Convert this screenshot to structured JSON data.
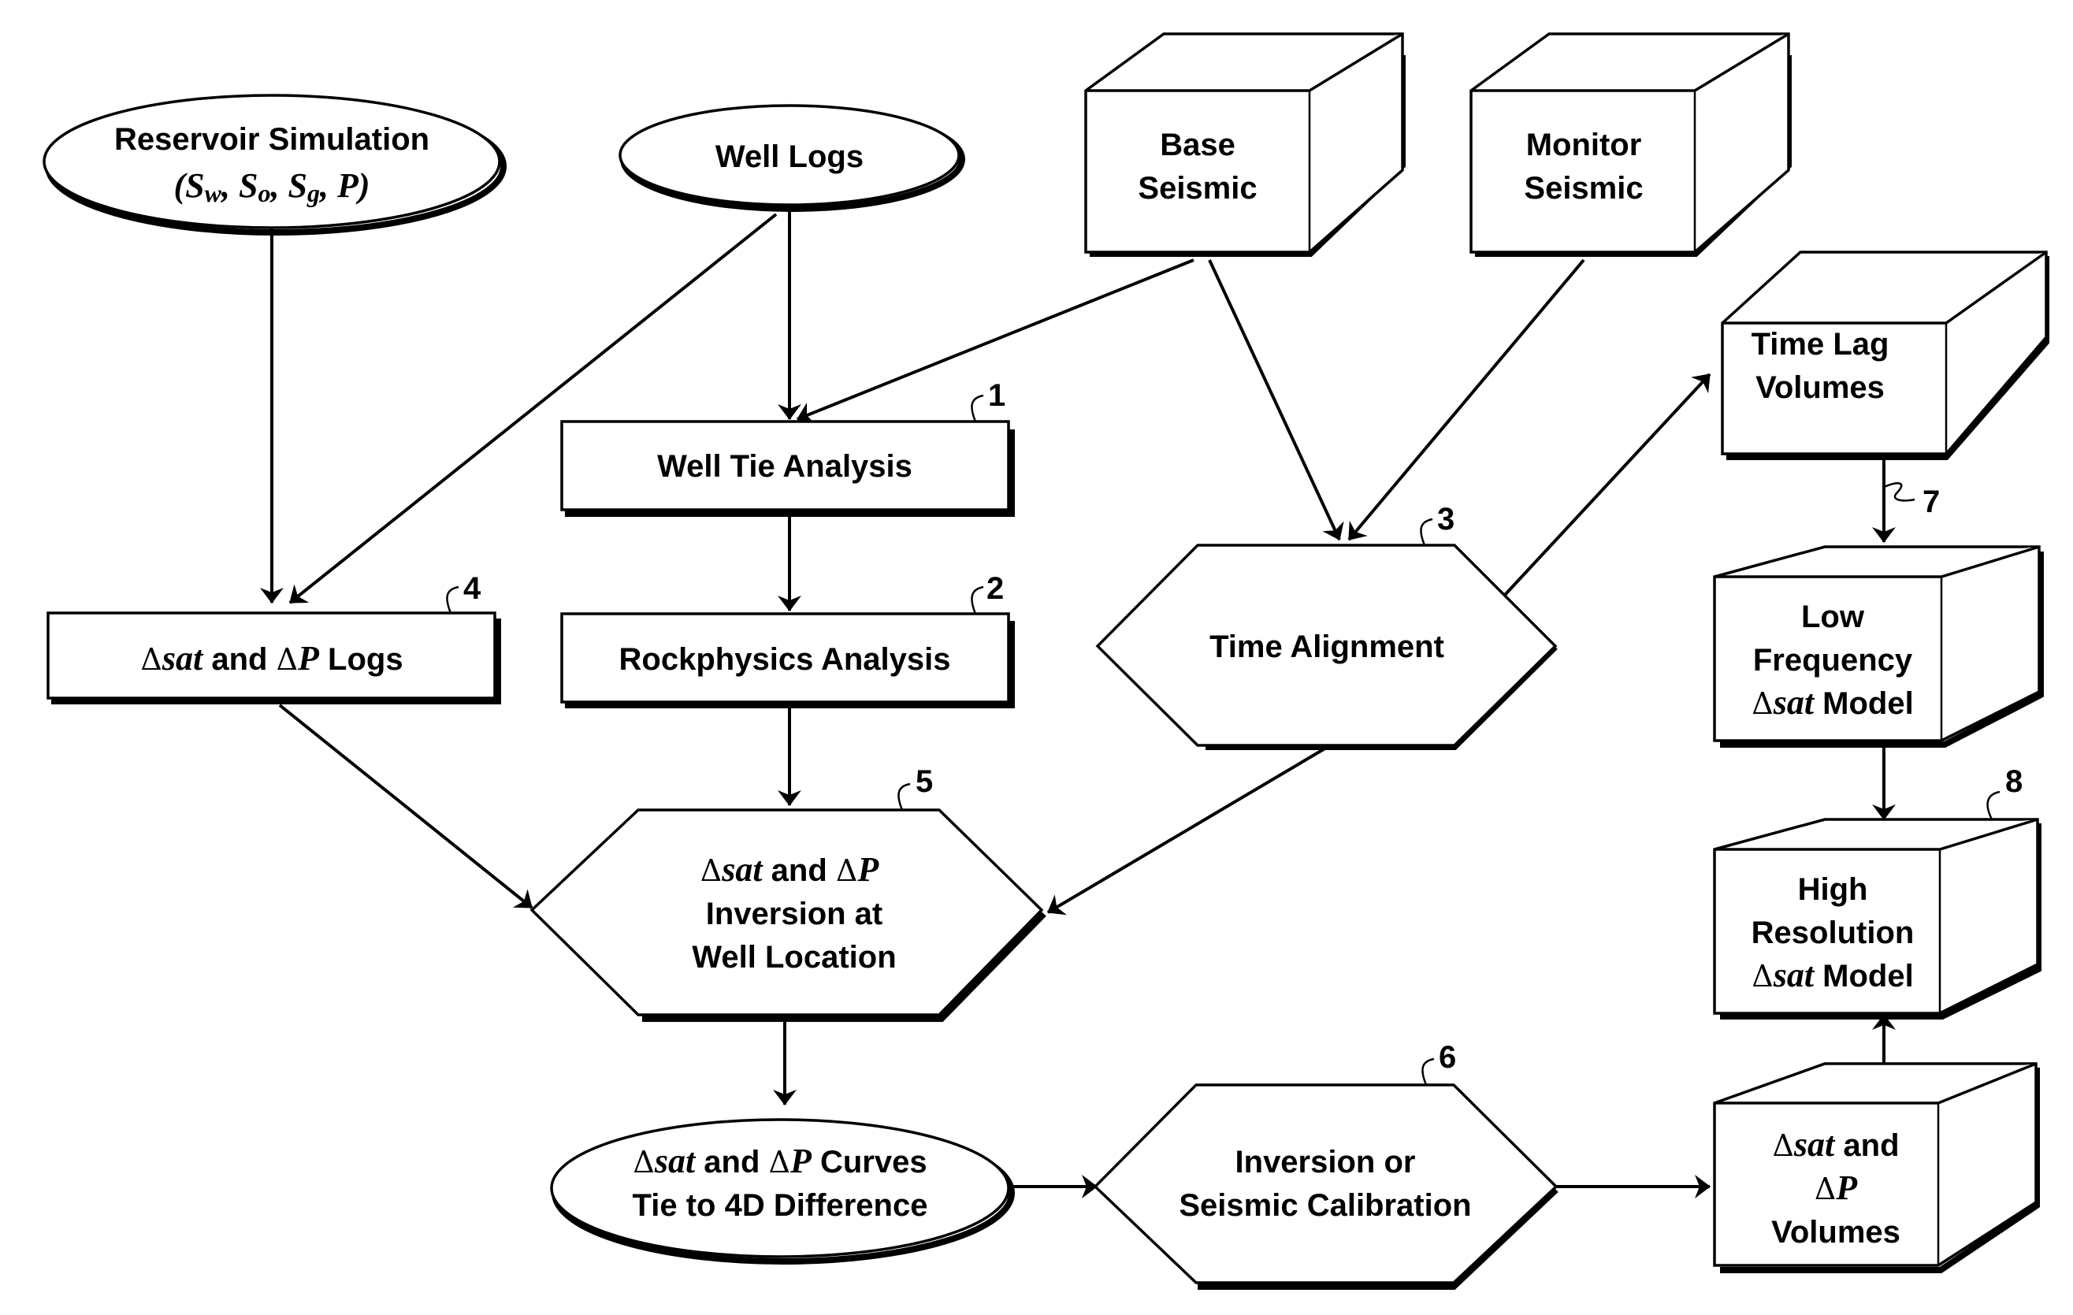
{
  "diagram": {
    "type": "flowchart",
    "nodes": {
      "reservoir_simulation": {
        "line1": "Reservoir Simulation",
        "line2_open": "(",
        "sw": "S",
        "sw_sub": "w",
        "so": "S",
        "so_sub": "o",
        "sg": "S",
        "sg_sub": "g",
        "p": "P",
        "comma": ", ",
        "line2_close": ")"
      },
      "well_logs": {
        "label": "Well Logs"
      },
      "base_seismic": {
        "line1": "Base",
        "line2": "Seismic"
      },
      "monitor_seismic": {
        "line1": "Monitor",
        "line2": "Seismic"
      },
      "time_lag_volumes": {
        "line1": "Time Lag",
        "line2": "Volumes"
      },
      "well_tie_analysis": {
        "label": "Well Tie Analysis",
        "ref": "1"
      },
      "rockphysics_analysis": {
        "label": "Rockphysics Analysis",
        "ref": "2"
      },
      "time_alignment": {
        "label": "Time Alignment",
        "ref": "3"
      },
      "sat_p_logs": {
        "delta": "Δ",
        "sat": "sat",
        "and": " and ",
        "p": "P",
        "tail": " Logs",
        "ref": "4"
      },
      "inversion_at_well": {
        "delta": "Δ",
        "sat": "sat",
        "and": " and ",
        "p": "P",
        "line2": "Inversion at",
        "line3": "Well Location",
        "ref": "5"
      },
      "curves_tie": {
        "delta": "Δ",
        "sat": "sat",
        "and": " and ",
        "p": "P",
        "tail": " Curves",
        "line2": "Tie to 4D Difference"
      },
      "inversion_calibration": {
        "line1": "Inversion or",
        "line2": "Seismic Calibration",
        "ref": "6"
      },
      "low_frequency_model": {
        "line1": "Low",
        "line2": "Frequency",
        "delta": "Δ",
        "sat": "sat",
        "tail": " Model",
        "ref": "7"
      },
      "high_resolution_model": {
        "line1": "High",
        "line2": "Resolution",
        "delta": "Δ",
        "sat": "sat",
        "tail": " Model",
        "ref": "8"
      },
      "sat_p_volumes": {
        "delta": "Δ",
        "sat": "sat",
        "and": " and",
        "p": "P",
        "line3": "Volumes"
      }
    },
    "edges": [
      [
        "reservoir_simulation",
        "sat_p_logs"
      ],
      [
        "well_logs",
        "sat_p_logs"
      ],
      [
        "well_logs",
        "well_tie_analysis"
      ],
      [
        "base_seismic",
        "well_tie_analysis"
      ],
      [
        "base_seismic",
        "time_alignment"
      ],
      [
        "monitor_seismic",
        "time_alignment"
      ],
      [
        "time_alignment",
        "time_lag_volumes"
      ],
      [
        "well_tie_analysis",
        "rockphysics_analysis"
      ],
      [
        "rockphysics_analysis",
        "inversion_at_well"
      ],
      [
        "sat_p_logs",
        "inversion_at_well"
      ],
      [
        "time_alignment",
        "inversion_at_well"
      ],
      [
        "inversion_at_well",
        "curves_tie",
        "bidirectional"
      ],
      [
        "curves_tie",
        "inversion_calibration"
      ],
      [
        "inversion_calibration",
        "sat_p_volumes"
      ],
      [
        "time_lag_volumes",
        "low_frequency_model"
      ],
      [
        "low_frequency_model",
        "high_resolution_model"
      ],
      [
        "sat_p_volumes",
        "high_resolution_model"
      ]
    ]
  }
}
